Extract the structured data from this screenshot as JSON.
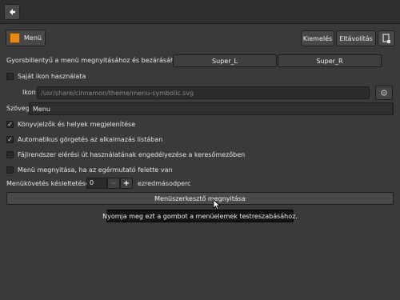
{
  "toolbar": {
    "back_icon": "arrow-left-icon"
  },
  "header": {
    "menu_label": "Menü",
    "highlight_label": "Kiemelés",
    "remove_label": "Eltávolítás"
  },
  "hotkey": {
    "label": "Gyorsbillentyű a menü megnyitásához és bezárásához",
    "key1": "Super_L",
    "key2": "Super_R"
  },
  "custom_icon": {
    "checkbox_label": "Saját ikon használata",
    "checked": false,
    "icon_label": "Ikon",
    "icon_path": "/usr/share/cinnamon/theme/menu-symbolic.svg"
  },
  "text_field": {
    "label": "Szöveg",
    "value": "Menu"
  },
  "options": [
    {
      "label": "Könyvjelzők és helyek megjelenítése",
      "checked": true
    },
    {
      "label": "Automatikus görgetés az alkalmazás listában",
      "checked": true
    },
    {
      "label": "Fájlrendszer elérési út használatának engedélyezése a keresőmezőben",
      "checked": false
    },
    {
      "label": "Menü megnyitása, ha az egérmutató felette van",
      "checked": false
    }
  ],
  "delay": {
    "label": "Menükövetés késleltetése:",
    "value": "0",
    "minus": "−",
    "plus": "+",
    "unit": "ezredmásodperc"
  },
  "editor_button": {
    "label": "Menüszerkesztő megnyitása"
  },
  "tooltip": {
    "text": "Nyomja meg ezt a gombot a menüelemek testreszabásához."
  },
  "colors": {
    "background": "#3a3a3a",
    "accent_icon": "#e58a1a"
  }
}
